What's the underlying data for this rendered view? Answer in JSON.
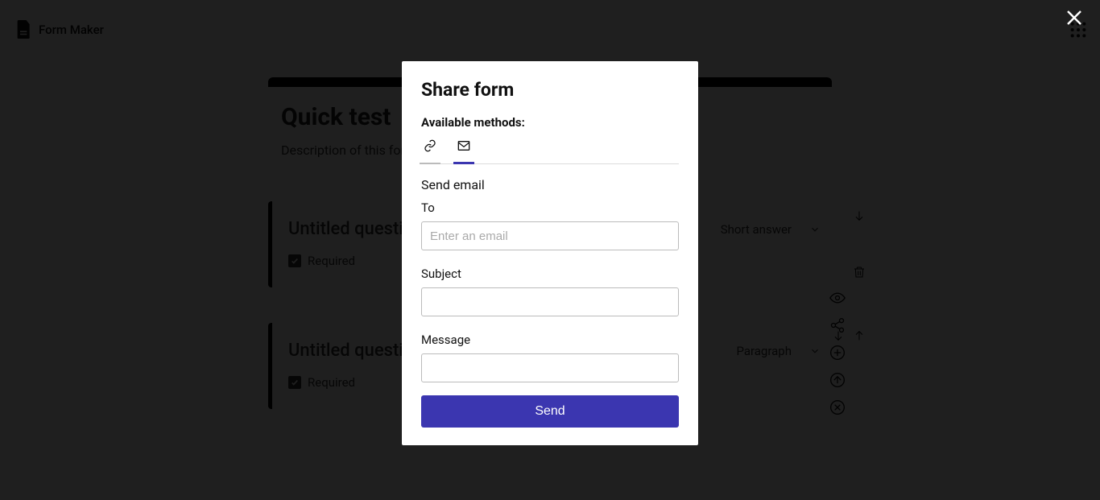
{
  "app": {
    "title": "Form Maker"
  },
  "form": {
    "title": "Quick test",
    "description": "Description of this form"
  },
  "questions": [
    {
      "title": "Untitled question",
      "type": "Short answer",
      "required_label": "Required",
      "required_checked": true
    },
    {
      "title": "Untitled question",
      "type": "Paragraph",
      "required_label": "Required",
      "required_checked": true
    }
  ],
  "modal": {
    "title": "Share form",
    "methods_label": "Available methods:",
    "section_heading": "Send email",
    "to_label": "To",
    "to_placeholder": "Enter an email",
    "to_value": "",
    "subject_label": "Subject",
    "subject_value": "",
    "message_label": "Message",
    "message_value": "",
    "send_label": "Send"
  }
}
